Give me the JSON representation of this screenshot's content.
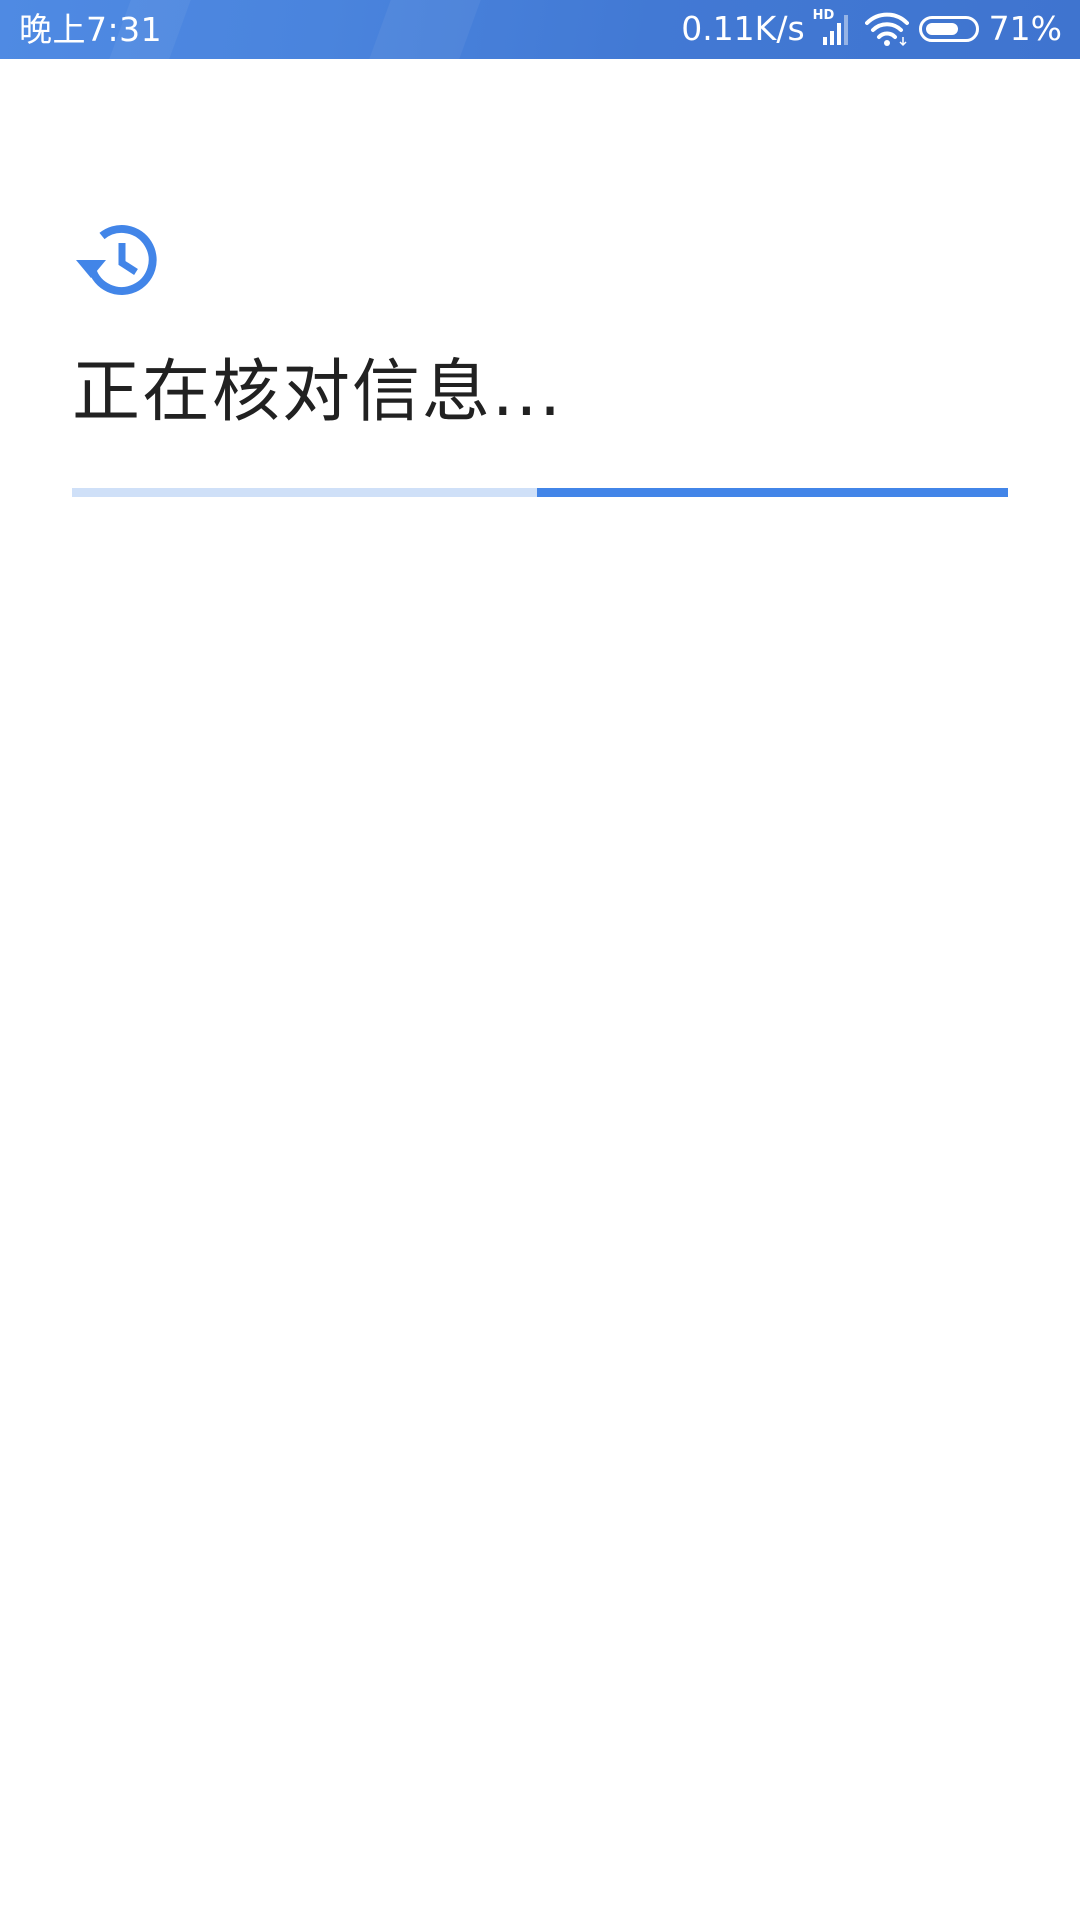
{
  "status_bar": {
    "time": "晚上7:31",
    "net_speed": "0.11K/s",
    "signal_badge": "HD",
    "battery_percent": "71%",
    "battery_level": 0.71
  },
  "icons": {
    "status": "history-icon",
    "signal": "signal-icon",
    "wifi": "wifi-icon",
    "battery": "battery-icon"
  },
  "main": {
    "title": "正在核对信息..."
  },
  "progress": {
    "buffer_start_fraction": 0.0,
    "value_start_fraction": 0.497,
    "value_end_fraction": 1.0
  },
  "colors": {
    "accent": "#4285e8",
    "track": "#cfe0f8",
    "status_bar": "#4a84dd",
    "text": "#212121"
  }
}
